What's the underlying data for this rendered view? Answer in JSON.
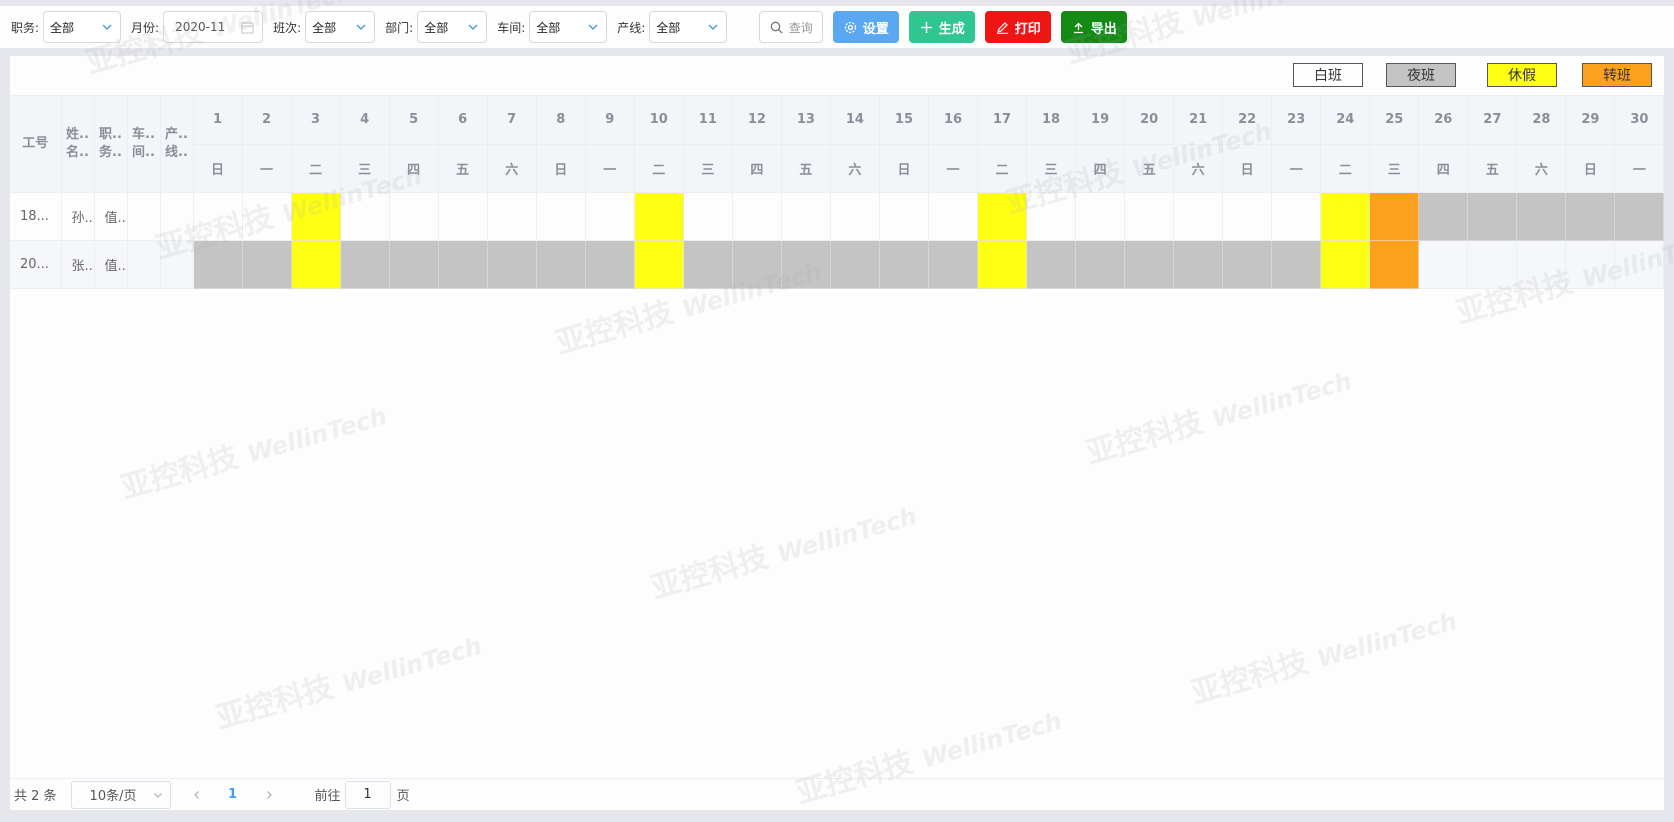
{
  "toolbar": {
    "filters": [
      {
        "label": "职务:",
        "value": "全部"
      },
      {
        "label": "月份:",
        "value": "2020-11"
      },
      {
        "label": "班次:",
        "value": "全部"
      },
      {
        "label": "部门:",
        "value": "全部"
      },
      {
        "label": "车间:",
        "value": "全部"
      },
      {
        "label": "产线:",
        "value": "全部"
      }
    ],
    "query_label": "查询",
    "set_label": "设置",
    "generate_label": "生成",
    "print_label": "打印",
    "export_label": "导出"
  },
  "legend": {
    "day": {
      "label": "白班",
      "color": "#fdfdfd"
    },
    "night": {
      "label": "夜班",
      "color": "#c4c4c4"
    },
    "leave": {
      "label": "休假",
      "color": "#ffff14"
    },
    "transfer": {
      "label": "转班",
      "color": "#fba11d"
    }
  },
  "table": {
    "fixed_headers": [
      {
        "line1": "工号",
        "line2": ""
      },
      {
        "line1": "姓..",
        "line2": "名.."
      },
      {
        "line1": "职..",
        "line2": "务.."
      },
      {
        "line1": "车..",
        "line2": "间.."
      },
      {
        "line1": "产..",
        "line2": "线.."
      }
    ],
    "days": [
      "1",
      "2",
      "3",
      "4",
      "5",
      "6",
      "7",
      "8",
      "9",
      "10",
      "11",
      "12",
      "13",
      "14",
      "15",
      "16",
      "17",
      "18",
      "19",
      "20",
      "21",
      "22",
      "23",
      "24",
      "25",
      "26",
      "27",
      "28",
      "29",
      "30"
    ],
    "weekdays": [
      "日",
      "一",
      "二",
      "三",
      "四",
      "五",
      "六",
      "日",
      "一",
      "二",
      "三",
      "四",
      "五",
      "六",
      "日",
      "一",
      "二",
      "三",
      "四",
      "五",
      "六",
      "日",
      "一",
      "二",
      "三",
      "四",
      "五",
      "六",
      "日",
      "一"
    ],
    "rows": [
      {
        "id": "18...",
        "name": "孙..",
        "duty": "值...",
        "workshop": "",
        "line": "",
        "cells": [
          "W",
          "W",
          "L",
          "W",
          "W",
          "W",
          "W",
          "W",
          "W",
          "L",
          "W",
          "W",
          "W",
          "W",
          "W",
          "W",
          "L",
          "W",
          "W",
          "W",
          "W",
          "W",
          "W",
          "L",
          "T",
          "N",
          "N",
          "N",
          "N",
          "N"
        ]
      },
      {
        "id": "20...",
        "name": "张..",
        "duty": "值...",
        "workshop": "",
        "line": "",
        "cells": [
          "N",
          "N",
          "L",
          "N",
          "N",
          "N",
          "N",
          "N",
          "N",
          "L",
          "N",
          "N",
          "N",
          "N",
          "N",
          "N",
          "L",
          "N",
          "N",
          "N",
          "N",
          "N",
          "N",
          "L",
          "T",
          "E",
          "E",
          "E",
          "E",
          "E"
        ]
      }
    ]
  },
  "pager": {
    "total": "共 2 条",
    "page_size": "10条/页",
    "current_page": "1",
    "goto_label": "前往",
    "goto_value": "1",
    "page_unit": "页"
  },
  "watermark": {
    "cn": "亚控科技",
    "en": "WellinTech"
  },
  "icons": {
    "select_chevron": "chevron-down-icon",
    "date": "calendar-icon",
    "query": "search-icon",
    "set": "gear-icon",
    "generate": "plus-icon",
    "print": "pencil-icon",
    "export": "upload-icon"
  }
}
